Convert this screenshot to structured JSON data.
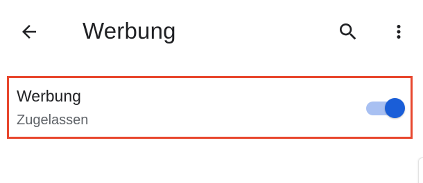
{
  "appbar": {
    "title": "Werbung",
    "back_icon": "arrow-back-icon",
    "search_icon": "search-icon",
    "more_icon": "more-vertical-icon"
  },
  "setting": {
    "title": "Werbung",
    "subtitle": "Zugelassen",
    "toggle_on": true,
    "highlight_color": "#e8472e",
    "toggle_color": "#1a5ed8",
    "toggle_track_color": "#a8c0f2"
  }
}
